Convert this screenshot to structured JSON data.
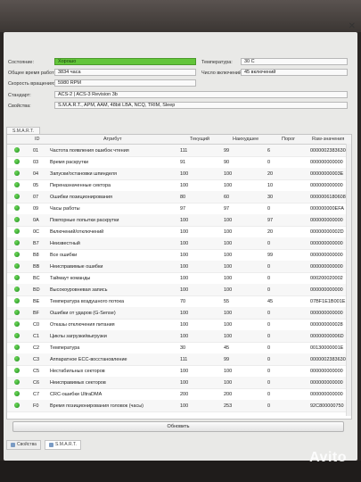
{
  "info": {
    "status_label": "Состояние:",
    "status_value": "Хорошо",
    "temp_label": "Температура:",
    "temp_value": "30 C",
    "uptime_label": "Общее время работы:",
    "uptime_value": "3834 часа",
    "power_label": "Число включений:",
    "power_value": "45 включений",
    "rpm_label": "Скорость вращения:",
    "rpm_value": "5980 RPM",
    "standard_label": "Стандарт:",
    "standard_value": "ACS-2 | ACS-3 Revision 3b",
    "features_label": "Свойства:",
    "features_value": "S.M.A.R.T., APM, AAM, 48bit LBA, NCQ, TRIM, Sleep"
  },
  "smart_tab": "S.M.A.R.T.",
  "columns": [
    "ID",
    "Атрибут",
    "Текущий",
    "Наихудшее",
    "Порог",
    "Raw-значения"
  ],
  "rows": [
    {
      "id": "01",
      "attr": "Частота появления ошибок чтения",
      "cur": "111",
      "worst": "99",
      "thr": "6",
      "raw": "0000002383630"
    },
    {
      "id": "03",
      "attr": "Время раскрутки",
      "cur": "91",
      "worst": "90",
      "thr": "0",
      "raw": "000000000000"
    },
    {
      "id": "04",
      "attr": "Запуски/остановки шпинделя",
      "cur": "100",
      "worst": "100",
      "thr": "20",
      "raw": "00000000003E"
    },
    {
      "id": "05",
      "attr": "Переназначенные сектора",
      "cur": "100",
      "worst": "100",
      "thr": "10",
      "raw": "000000000000"
    },
    {
      "id": "07",
      "attr": "Ошибки позиционирования",
      "cur": "80",
      "worst": "60",
      "thr": "30",
      "raw": "0000006180608"
    },
    {
      "id": "09",
      "attr": "Часы работы",
      "cur": "97",
      "worst": "97",
      "thr": "0",
      "raw": "000000000EFA"
    },
    {
      "id": "0A",
      "attr": "Повторные попытки раскрутки",
      "cur": "100",
      "worst": "100",
      "thr": "97",
      "raw": "000000000000"
    },
    {
      "id": "0C",
      "attr": "Включений/отключений",
      "cur": "100",
      "worst": "100",
      "thr": "20",
      "raw": "00000000002D"
    },
    {
      "id": "B7",
      "attr": "Неизвестный",
      "cur": "100",
      "worst": "100",
      "thr": "0",
      "raw": "000000000000"
    },
    {
      "id": "B8",
      "attr": "Все ошибки",
      "cur": "100",
      "worst": "100",
      "thr": "99",
      "raw": "000000000000"
    },
    {
      "id": "BB",
      "attr": "Неисправимые ошибки",
      "cur": "100",
      "worst": "100",
      "thr": "0",
      "raw": "000000000000"
    },
    {
      "id": "BC",
      "attr": "Таймаут команды",
      "cur": "100",
      "worst": "100",
      "thr": "0",
      "raw": "000200020002"
    },
    {
      "id": "BD",
      "attr": "Высокоуровневая запись",
      "cur": "100",
      "worst": "100",
      "thr": "0",
      "raw": "000000000000"
    },
    {
      "id": "BE",
      "attr": "Температура воздушного потока",
      "cur": "70",
      "worst": "55",
      "thr": "45",
      "raw": "07BF1E1B001E"
    },
    {
      "id": "BF",
      "attr": "Ошибки от ударов (G-Sense)",
      "cur": "100",
      "worst": "100",
      "thr": "0",
      "raw": "000000000000"
    },
    {
      "id": "C0",
      "attr": "Отказы отключения питания",
      "cur": "100",
      "worst": "100",
      "thr": "0",
      "raw": "000000000028"
    },
    {
      "id": "C1",
      "attr": "Циклы загрузки/выгрузки",
      "cur": "100",
      "worst": "100",
      "thr": "0",
      "raw": "00000000006D"
    },
    {
      "id": "C2",
      "attr": "Температура",
      "cur": "30",
      "worst": "45",
      "thr": "0",
      "raw": "00130000001E"
    },
    {
      "id": "C3",
      "attr": "Аппаратное ECC-восстановление",
      "cur": "111",
      "worst": "99",
      "thr": "0",
      "raw": "0000002383630"
    },
    {
      "id": "C5",
      "attr": "Нестабильных секторов",
      "cur": "100",
      "worst": "100",
      "thr": "0",
      "raw": "000000000000"
    },
    {
      "id": "C6",
      "attr": "Неисправимых секторов",
      "cur": "100",
      "worst": "100",
      "thr": "0",
      "raw": "000000000000"
    },
    {
      "id": "C7",
      "attr": "CRC-ошибки UltraDMA",
      "cur": "200",
      "worst": "200",
      "thr": "0",
      "raw": "000000000000"
    },
    {
      "id": "F0",
      "attr": "Время позиционирования головок (часы)",
      "cur": "100",
      "worst": "253",
      "thr": "0",
      "raw": "92C800000750"
    }
  ],
  "update_button": "Обновить",
  "bottom_tabs": [
    "Свойства",
    "S.M.A.R.T."
  ],
  "watermark": "Avito",
  "colors": {
    "ok_green": "#63c53a",
    "dot_green": "#1b8c1b"
  }
}
